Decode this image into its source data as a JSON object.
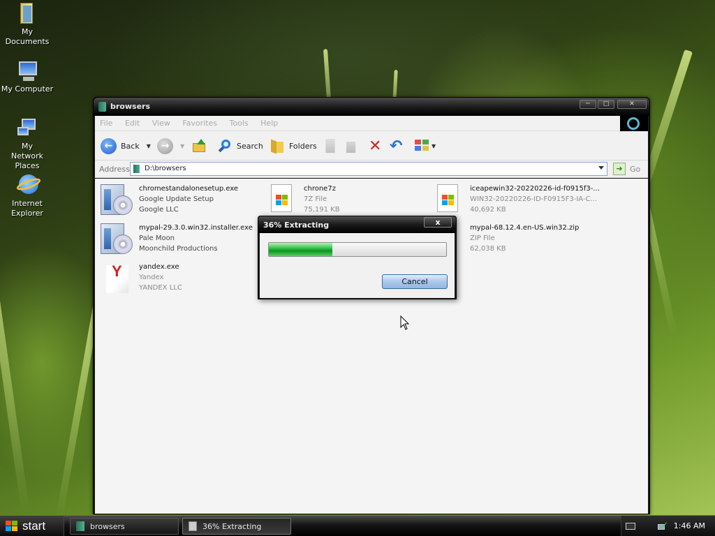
{
  "desktop": {
    "icons": [
      {
        "label": "My Documents"
      },
      {
        "label": "My Computer"
      },
      {
        "label": "My Network Places"
      },
      {
        "label": "Internet Explorer"
      }
    ]
  },
  "window": {
    "title": "browsers",
    "menu": [
      "File",
      "Edit",
      "View",
      "Favorites",
      "Tools",
      "Help"
    ],
    "toolbar": {
      "back_label": "Back",
      "search_label": "Search",
      "folders_label": "Folders"
    },
    "address": {
      "label": "Address",
      "value": "D:\\browsers",
      "go_label": "Go"
    },
    "files": [
      {
        "name": "chromestandalonesetup.exe",
        "line2": "Google Update Setup",
        "line3": "Google LLC",
        "icon": "installer-icon"
      },
      {
        "name": "chrone7z",
        "line2": "7Z File",
        "line3": "75,191 KB",
        "icon": "file-icon"
      },
      {
        "name": "iceapewin32-20220226-id-f0915f3-...",
        "line2": "WIN32-20220226-ID-F0915F3-IA-C...",
        "line3": "40,692 KB",
        "icon": "file-icon"
      },
      {
        "name": "mypal-29.3.0.win32.installer.exe",
        "line2": "Pale Moon",
        "line3": "Moonchild Productions",
        "icon": "installer-icon"
      },
      {
        "name": "mypal-68.12.4.en-US.win32.zip",
        "line2": "ZIP File",
        "line3": "62,038 KB",
        "icon": "file-icon"
      },
      {
        "name": "yandex.exe",
        "line2": "Yandex",
        "line3": "YANDEX LLC",
        "icon": "yandex-icon"
      }
    ]
  },
  "dialog": {
    "title": "36% Extracting",
    "progress_percent": 36,
    "cancel_label": "Cancel",
    "close_label": "x"
  },
  "taskbar": {
    "start_label": "start",
    "tasks": [
      {
        "label": "browsers"
      },
      {
        "label": "36% Extracting"
      }
    ],
    "clock": "1:46 AM"
  }
}
